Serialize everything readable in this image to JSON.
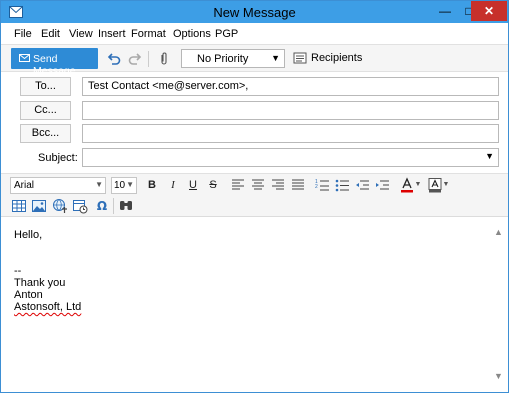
{
  "window": {
    "title": "New Message"
  },
  "menubar": {
    "items": [
      "File",
      "Edit",
      "View",
      "Insert",
      "Format",
      "Options",
      "PGP"
    ]
  },
  "toolbar": {
    "send_label": "Send Message",
    "priority_value": "No Priority",
    "recipients_label": "Recipients"
  },
  "headers": {
    "to_label": "To...",
    "to_value": "Test Contact <me@server.com>,",
    "cc_label": "Cc...",
    "cc_value": "",
    "bcc_label": "Bcc...",
    "bcc_value": "",
    "subject_label": "Subject:",
    "subject_value": ""
  },
  "format": {
    "font": "Arial",
    "size": "10",
    "bold": "B",
    "italic": "I",
    "underline": "U",
    "strike": "S"
  },
  "body": {
    "lines": [
      "Hello,",
      "",
      "",
      "--",
      "Thank you",
      "Anton",
      "Astonsoft, Ltd"
    ]
  },
  "colors": {
    "titlebar": "#3d9ee6",
    "send_button": "#2e8bd6",
    "close_button": "#c7302b"
  }
}
